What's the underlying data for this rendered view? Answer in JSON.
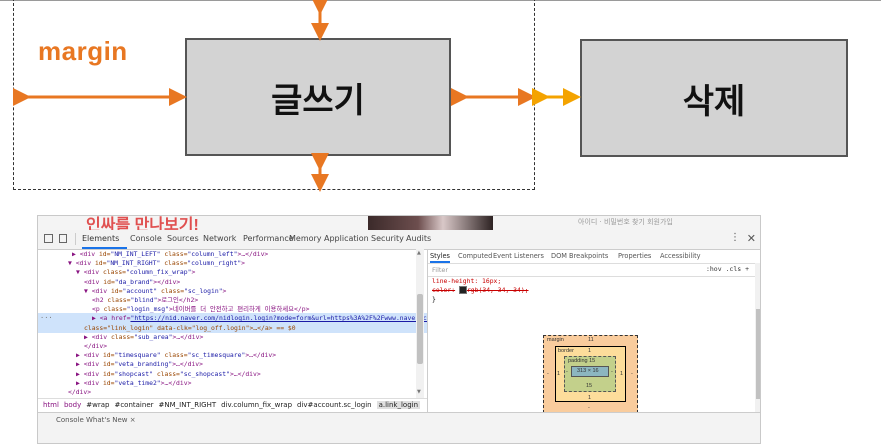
{
  "diagram": {
    "margin_label": "margin",
    "write_button": "글쓰기",
    "delete_button": "삭제",
    "arrow_color": "#e87722",
    "arrow_light_color": "#f4a300"
  },
  "devtools": {
    "page_peek_text": "인싸를 만나보기!",
    "page_peek_right": "아이디 · 비밀번호 찾기        회원가입",
    "tabs": [
      "Elements",
      "Console",
      "Sources",
      "Network",
      "Performance",
      "Memory",
      "Application",
      "Security",
      "Audits"
    ],
    "elements_lines": [
      {
        "pre": "▶ <",
        "tag": "div",
        "attr": " id=",
        "val": "\"NM_INT_LEFT\"",
        "attr2": " class=",
        "val2": "\"column_left\"",
        "post": ">…</div>"
      },
      {
        "pre": "▼ <",
        "tag": "div",
        "attr": " id=",
        "val": "\"NM_INT_RIGHT\"",
        "attr2": " class=",
        "val2": "\"column_right\"",
        "post": ">"
      },
      {
        "pre": "▼ <",
        "tag": "div",
        "attr": " class=",
        "val": "\"column_fix_wrap\"",
        "attr2": "",
        "val2": "",
        "post": ">"
      },
      {
        "pre": "<",
        "tag": "div",
        "attr": " id=",
        "val": "\"da_brand\"",
        "attr2": "",
        "val2": "",
        "post": "></div>"
      },
      {
        "pre": "▼ <",
        "tag": "div",
        "attr": " id=",
        "val": "\"account\"",
        "attr2": " class=",
        "val2": "\"sc_login\"",
        "post": ">"
      },
      {
        "pre": "<",
        "tag": "h2",
        "attr": " class=",
        "val": "\"blind\"",
        "attr2": "",
        "val2": "",
        "post": ">로그인</h2>"
      },
      {
        "pre": "<",
        "tag": "p",
        "attr": " class=",
        "val": "\"login_msg\"",
        "attr2": "",
        "val2": "",
        "post": ">네이버를 더 안전하고 편리하게 이용하세요</p>"
      }
    ],
    "selected_line_1_pre": "▶ <a href=",
    "selected_link": "\"https://nid.naver.com/nidlogin.login?mode=form&url=https%3A%2F%2Fwww.naver.com\"",
    "selected_line_2": "class=\"link_login\" data-clk=\"log_off.login\">…</a> == $0",
    "elements_tail": [
      {
        "pre": "▶ <",
        "tag": "div",
        "attr": " class=",
        "val": "\"sub_area\"",
        "attr2": "",
        "val2": "",
        "post": ">…</div>"
      },
      {
        "pre": "</",
        "tag": "div",
        "attr": "",
        "val": "",
        "attr2": "",
        "val2": "",
        "post": ">"
      },
      {
        "pre": "▶ <",
        "tag": "div",
        "attr": " id=",
        "val": "\"timesquare\"",
        "attr2": " class=",
        "val2": "\"sc_timesquare\"",
        "post": ">…</div>"
      },
      {
        "pre": "▶ <",
        "tag": "div",
        "attr": " id=",
        "val": "\"veta_branding\"",
        "attr2": "",
        "val2": "",
        "post": ">…</div>"
      },
      {
        "pre": "▶ <",
        "tag": "div",
        "attr": " id=",
        "val": "\"shopcast\"",
        "attr2": " class=",
        "val2": "\"sc_shopcast\"",
        "post": ">…</div>"
      },
      {
        "pre": "▶ <",
        "tag": "div",
        "attr": " id=",
        "val": "\"veta_time2\"",
        "attr2": "",
        "val2": "",
        "post": ">…</div>"
      },
      {
        "pre": "</",
        "tag": "div",
        "attr": "",
        "val": "",
        "attr2": "",
        "val2": "",
        "post": ">"
      }
    ],
    "breadcrumbs": [
      "html",
      "body",
      "#wrap",
      "#container",
      "#NM_INT_RIGHT",
      "div.column_fix_wrap",
      "div#account.sc_login",
      "a.link_login"
    ],
    "console_peek": "Console    What's New ×",
    "styles_tabs": [
      "Styles",
      "Computed",
      "Event Listeners",
      "DOM Breakpoints",
      "Properties",
      "Accessibility"
    ],
    "filter_placeholder": "Filter",
    "filter_options": ":hov  .cls  +",
    "css_lines": {
      "line1": "line-height: 16px;",
      "line2_prop": "color:",
      "line2_val": "rgb(34, 34, 34);",
      "line3": "}"
    },
    "box_model": {
      "margin_label": "margin",
      "margin_top": "11",
      "margin_bottom": "-",
      "margin_left": "-",
      "margin_right": "-",
      "border_label": "border",
      "border_value": "1",
      "padding_label": "padding 15",
      "padding_side": "-",
      "padding_bottom": "15",
      "content": "313 × 16"
    }
  }
}
